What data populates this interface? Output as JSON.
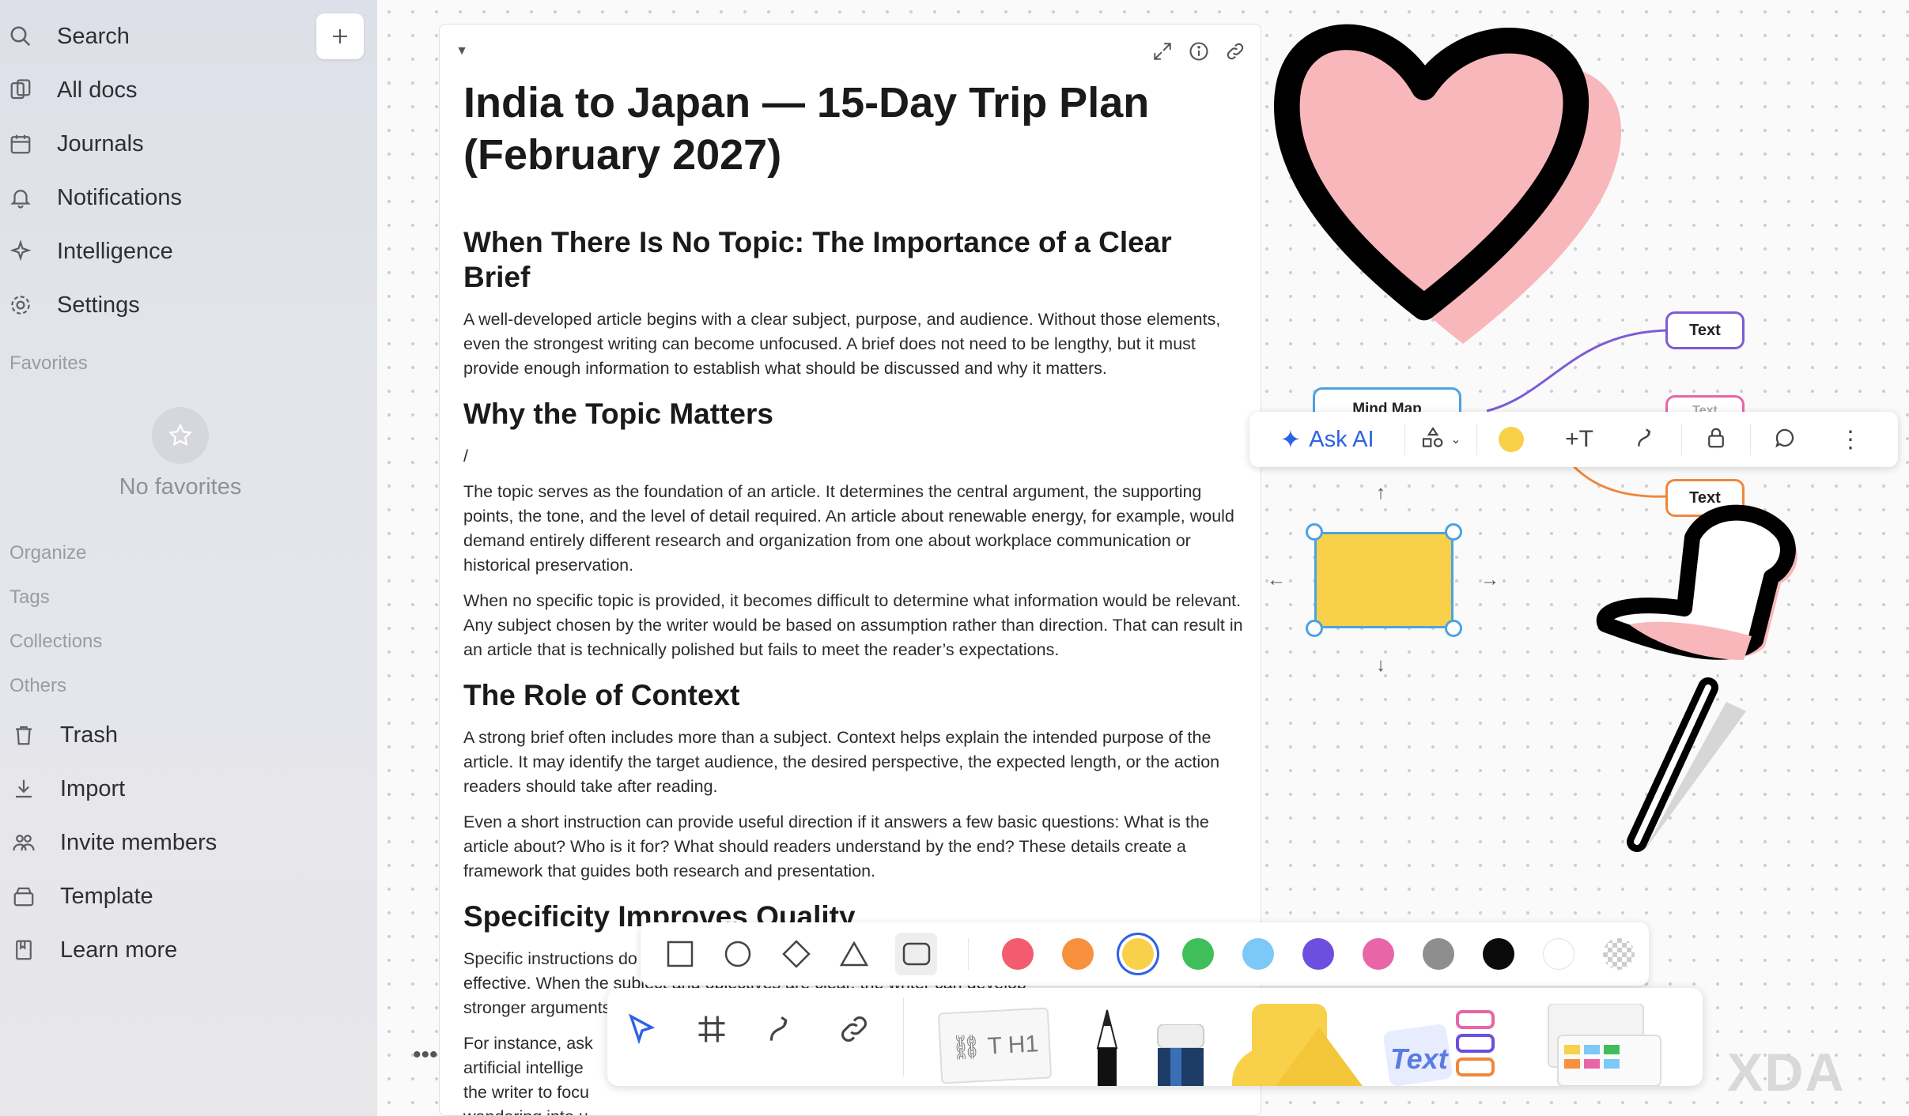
{
  "sidebar": {
    "nav": [
      {
        "label": "Search",
        "icon": "search-icon"
      },
      {
        "label": "All docs",
        "icon": "docs-icon"
      },
      {
        "label": "Journals",
        "icon": "calendar-icon"
      },
      {
        "label": "Notifications",
        "icon": "bell-icon"
      },
      {
        "label": "Intelligence",
        "icon": "sparkle-icon"
      },
      {
        "label": "Settings",
        "icon": "gear-icon"
      }
    ],
    "favorites_label": "Favorites",
    "no_favorites": "No favorites",
    "organize_label": "Organize",
    "tags_label": "Tags",
    "collections_label": "Collections",
    "others_label": "Others",
    "bottom": [
      {
        "label": "Trash",
        "icon": "trash-icon"
      },
      {
        "label": "Import",
        "icon": "import-icon"
      },
      {
        "label": "Invite members",
        "icon": "users-icon"
      },
      {
        "label": "Template",
        "icon": "template-icon"
      },
      {
        "label": "Learn more",
        "icon": "book-icon"
      }
    ]
  },
  "doc": {
    "title": "India to Japan — 15-Day Trip Plan (February 2027)",
    "sections": [
      {
        "heading": "When There Is No Topic: The Importance of a Clear Brief",
        "paragraphs": [
          "A well-developed article begins with a clear subject, purpose, and audience. Without those elements, even the strongest writing can become unfocused. A brief does not need to be lengthy, but it must provide enough information to establish what should be discussed and why it matters."
        ]
      },
      {
        "heading": "Why the Topic Matters",
        "paragraphs": [
          "/",
          "The topic serves as the foundation of an article. It determines the central argument, the supporting points, the tone, and the level of detail required. An article about renewable energy, for example, would demand entirely different research and organization from one about workplace communication or historical preservation.",
          "When no specific topic is provided, it becomes difficult to determine what information would be relevant. Any subject chosen by the writer would be based on assumption rather than direction. That can result in an article that is technically polished but fails to meet the reader’s expectations."
        ]
      },
      {
        "heading": "The Role of Context",
        "paragraphs": [
          "A strong brief often includes more than a subject. Context helps explain the intended purpose of the article. It may identify the target audience, the desired perspective, the expected length, or the action readers should take after reading.",
          "Even a short instruction can provide useful direction if it answers a few basic questions: What is the article about? Who is it for? What should readers understand by the end? These details create a framework that guides both research and presentation."
        ]
      },
      {
        "heading": "Specificity Improves Quality",
        "paragraphs": [
          "Specific instructions do not limit creativity; they make creativity more effective. When the subject and objectives are clear, the writer can develop stronger arguments, and create",
          "For instance, ask artificial intellige the writer to focu wandering into u"
        ]
      }
    ]
  },
  "toolbar": {
    "ask_ai": "Ask AI",
    "fill_color": "#F8D04A"
  },
  "mindmap": {
    "node_text_1": "Text",
    "node_text_2": "Text",
    "node_root": "Mind Map",
    "node_partial": "Text"
  },
  "colors": [
    "#F25C6E",
    "#F7913D",
    "#F8D04A",
    "#3FBF5A",
    "#7CC8F6",
    "#6D4FE0",
    "#E865A8",
    "#8E8E8E",
    "#0B0B0B",
    "#FFFFFF"
  ],
  "watermark": "XDA"
}
